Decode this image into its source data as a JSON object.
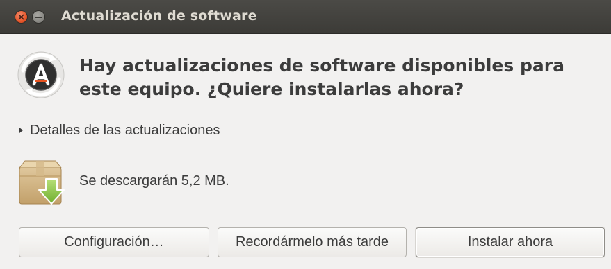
{
  "window": {
    "title": "Actualización de software"
  },
  "main": {
    "headline": "Hay actualizaciones de software disponibles para este equipo. ¿Quiere instalarlas ahora?",
    "details_label": "Detalles de las actualizaciones",
    "download_size_text": "Se descargarán 5,2 MB."
  },
  "buttons": {
    "settings": "Configuración…",
    "remind_later": "Recordármelo más tarde",
    "install_now": "Instalar ahora"
  },
  "icons": {
    "app": "software-updater-icon",
    "package": "package-download-icon",
    "close": "close-icon",
    "minimize": "minimize-icon",
    "expander": "expander-arrow-icon"
  },
  "colors": {
    "titlebar": "#3c3b37",
    "close_button": "#e5562a",
    "window_background": "#f2f1f0",
    "text": "#3c3c3c"
  }
}
